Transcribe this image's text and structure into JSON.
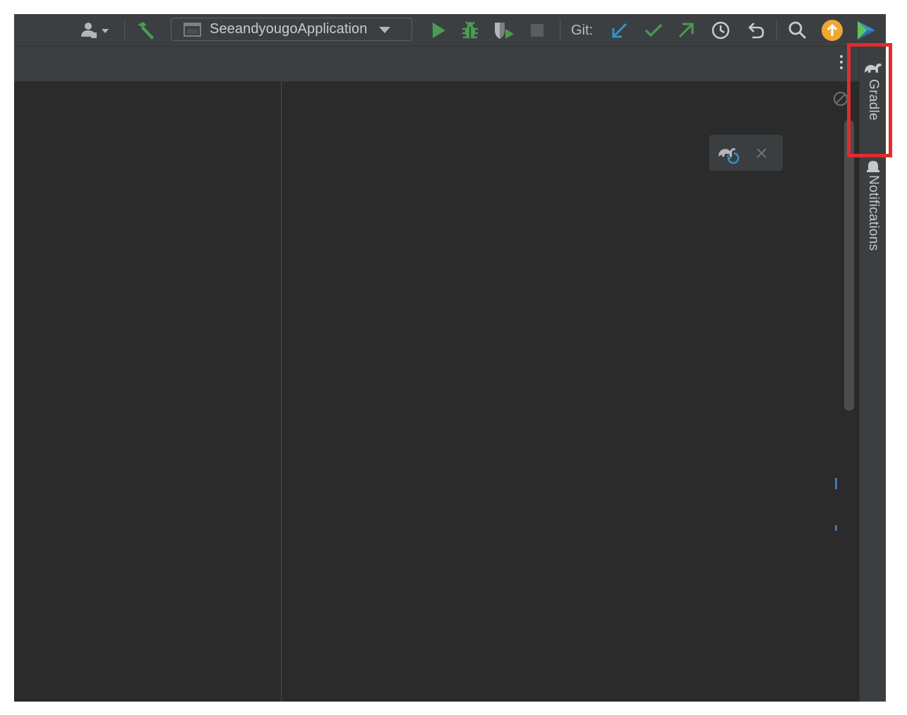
{
  "toolbar": {
    "run_config_label": "SeeandyougoApplication",
    "git_label": "Git:",
    "icons": {
      "user": "user-icon",
      "build": "hammer-icon",
      "run": "run-icon",
      "debug": "debug-icon",
      "coverage": "coverage-icon",
      "stop": "stop-icon",
      "update": "git-update-icon",
      "commit": "git-commit-icon",
      "push": "git-push-icon",
      "history": "history-icon",
      "rollback": "rollback-icon",
      "search": "search-icon",
      "upgrade": "upgrade-icon",
      "plugin": "plugin-icon"
    }
  },
  "right_bar": {
    "gradle_label": "Gradle",
    "notifications_label": "Notifications"
  },
  "colors": {
    "background": "#2b2b2b",
    "panel": "#3c3f41",
    "accent_green": "#499c54",
    "accent_blue": "#3592c4",
    "highlight_red": "#e22b2b",
    "upgrade_orange": "#f0a732"
  }
}
